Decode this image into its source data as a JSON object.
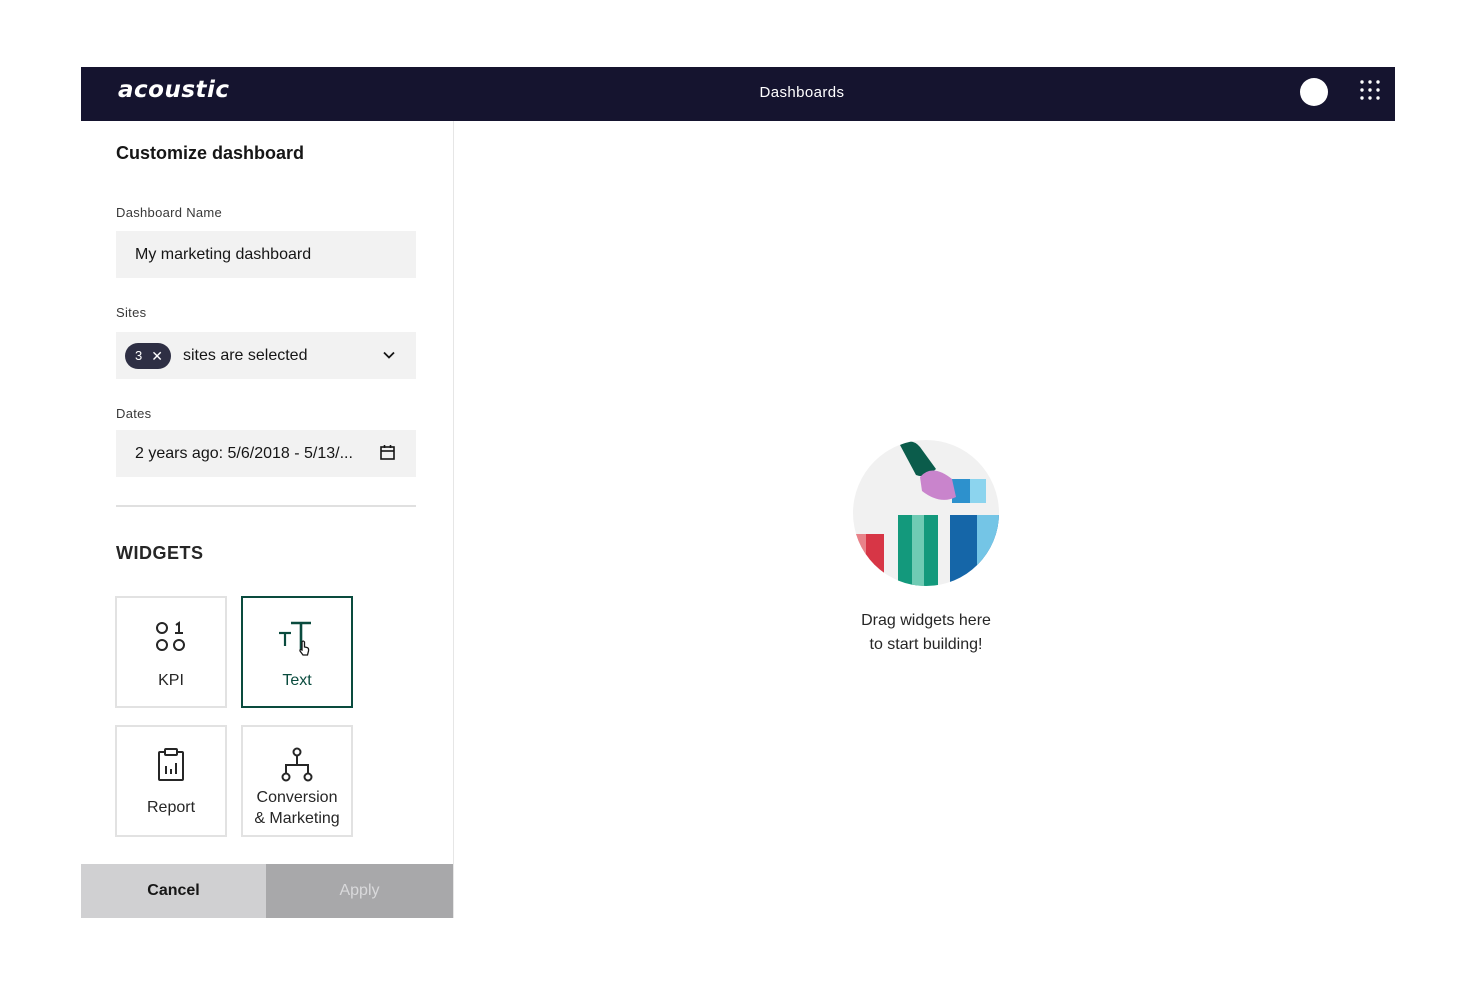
{
  "header": {
    "logo": "acoustic",
    "title": "Dashboards"
  },
  "sidebar": {
    "title": "Customize dashboard",
    "dashboard_name": {
      "label": "Dashboard Name",
      "value": "My marketing dashboard"
    },
    "sites": {
      "label": "Sites",
      "count": "3",
      "value": "sites are selected"
    },
    "dates": {
      "label": "Dates",
      "value": "2 years ago: 5/6/2018 - 5/13/..."
    },
    "widgets": {
      "heading": "WIDGETS",
      "items": [
        {
          "label": "KPI",
          "icon": "kpi-icon"
        },
        {
          "label": "Text",
          "icon": "text-icon",
          "selected": true
        },
        {
          "label": "Report",
          "icon": "report-icon"
        },
        {
          "label": "Conversion & Marketing",
          "line1": "Conversion",
          "line2": "& Marketing",
          "icon": "conversion-icon"
        }
      ]
    },
    "footer": {
      "cancel_label": "Cancel",
      "apply_label": "Apply"
    }
  },
  "canvas": {
    "empty_line1": "Drag widgets here",
    "empty_line2": "to start building!"
  },
  "colors": {
    "header_bg": "#15142f",
    "accent_green": "#0a4b3e",
    "field_bg": "#f2f2f2"
  }
}
